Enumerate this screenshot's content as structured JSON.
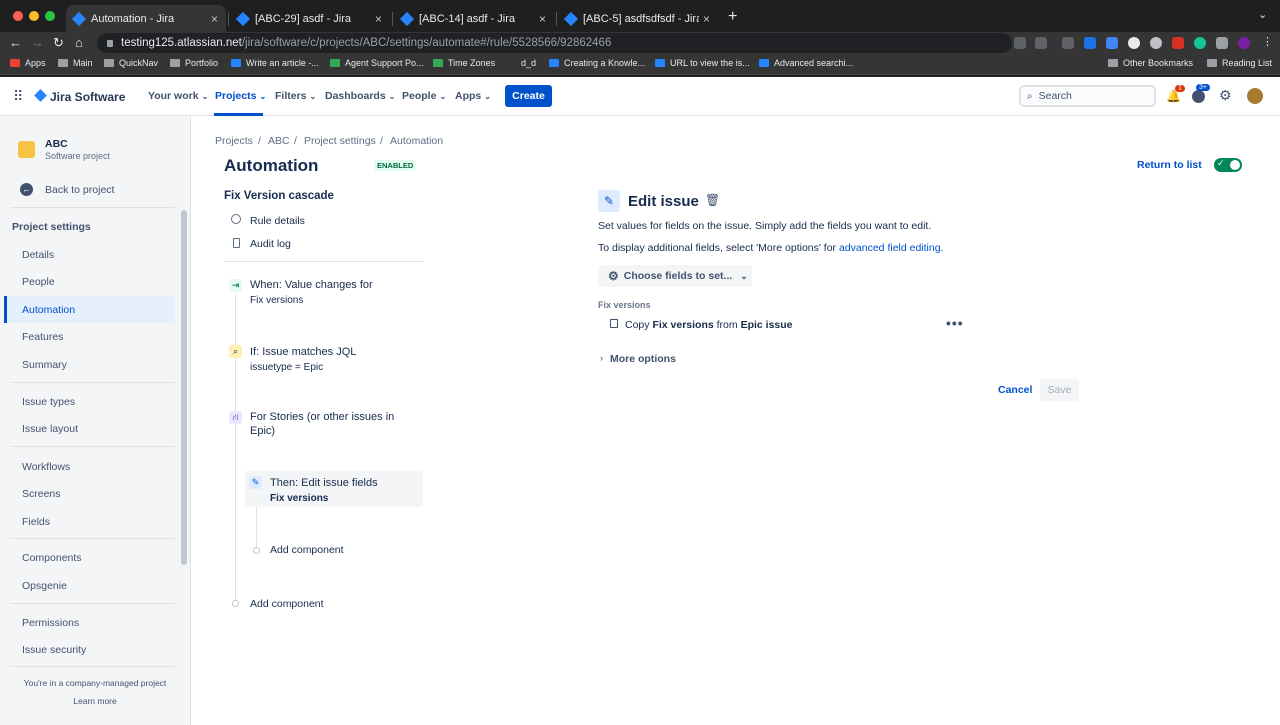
{
  "browser": {
    "tabs": [
      {
        "title": "Automation - Jira"
      },
      {
        "title": "[ABC-29] asdf - Jira"
      },
      {
        "title": "[ABC-14] asdf - Jira"
      },
      {
        "title": "[ABC-5] asdfsdfsdf - Jira"
      }
    ],
    "url_host": "testing125.atlassian.net",
    "url_path": "/jira/software/c/projects/ABC/settings/automate#/rule/5528566/92862466",
    "bookmarks": [
      "Apps",
      "Main",
      "QuickNav",
      "Portfolio",
      "Write an article -...",
      "Agent Support Po...",
      "Time Zones",
      "d_d",
      "Creating a Knowle...",
      "URL to view the is...",
      "Advanced searchi..."
    ],
    "other_bookmarks": "Other Bookmarks",
    "reading_list": "Reading List"
  },
  "topnav": {
    "product": "Jira Software",
    "menus": [
      "Your work",
      "Projects",
      "Filters",
      "Dashboards",
      "People",
      "Apps"
    ],
    "create": "Create",
    "search_placeholder": "Search",
    "notif_count": "1",
    "help_count": "3+"
  },
  "sidebar": {
    "project_name": "ABC",
    "project_type": "Software project",
    "back": "Back to project",
    "section": "Project settings",
    "items": [
      "Details",
      "People",
      "Automation",
      "Features",
      "Summary",
      "Issue types",
      "Issue layout",
      "Workflows",
      "Screens",
      "Fields",
      "Components",
      "Opsgenie",
      "Permissions",
      "Issue security"
    ],
    "footer": "You're in a company-managed project",
    "learn_more": "Learn more"
  },
  "breadcrumb": [
    "Projects",
    "ABC",
    "Project settings",
    "Automation"
  ],
  "page": {
    "title": "Automation",
    "badge": "ENABLED",
    "return": "Return to list",
    "rule_name": "Fix Version cascade",
    "rule_details": "Rule details",
    "audit_log": "Audit log"
  },
  "flow": {
    "trigger_title": "When: Value changes for",
    "trigger_sub": "Fix versions",
    "cond_title": "If: Issue matches JQL",
    "cond_sub": "issuetype = Epic",
    "branch_title": "For Stories (or other issues in",
    "branch_title2": "Epic)",
    "action_title": "Then: Edit issue fields",
    "action_sub": "Fix versions",
    "add_inner": "Add component",
    "add_outer": "Add component"
  },
  "editor": {
    "title": "Edit issue",
    "desc": "Set values for fields on the issue. Simply add the fields you want to edit.",
    "desc2_prefix": "To display additional fields, select 'More options' for",
    "desc2_link": "advanced field editing.",
    "choose_fields": "Choose fields to set...",
    "field_label": "Fix versions",
    "copy_pre": "Copy",
    "copy_field": "Fix versions",
    "copy_mid": "from",
    "copy_src": "Epic issue",
    "more_options": "More options",
    "cancel": "Cancel",
    "save": "Save"
  }
}
